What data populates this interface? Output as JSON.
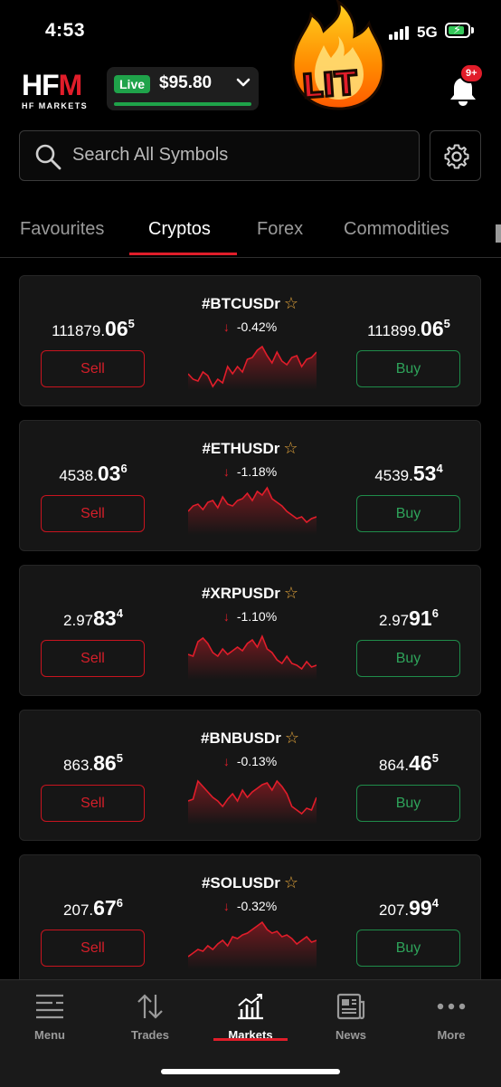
{
  "status": {
    "time": "4:53",
    "network": "5G"
  },
  "header": {
    "logo": {
      "mark": "HFM",
      "subtitle": "HF MARKETS"
    },
    "account": {
      "mode": "Live",
      "balance": "$95.80"
    },
    "sticker": {
      "text": "LIT"
    },
    "notifications": {
      "badge": "9+"
    }
  },
  "search": {
    "placeholder": "Search All Symbols"
  },
  "tabs": [
    "Favourites",
    "Cryptos",
    "Forex",
    "Commodities"
  ],
  "active_tab": "Cryptos",
  "instruments": [
    {
      "symbol": "#BTCUSDr",
      "change": "-0.42%",
      "sell": {
        "base": "111879.",
        "big": "06",
        "sup": "5"
      },
      "buy": {
        "base": "111899.",
        "big": "06",
        "sup": "5"
      },
      "sell_label": "Sell",
      "buy_label": "Buy"
    },
    {
      "symbol": "#ETHUSDr",
      "change": "-1.18%",
      "sell": {
        "base": "4538.",
        "big": "03",
        "sup": "6"
      },
      "buy": {
        "base": "4539.",
        "big": "53",
        "sup": "4"
      },
      "sell_label": "Sell",
      "buy_label": "Buy"
    },
    {
      "symbol": "#XRPUSDr",
      "change": "-1.10%",
      "sell": {
        "base": "2.97",
        "big": "83",
        "sup": "4"
      },
      "buy": {
        "base": "2.97",
        "big": "91",
        "sup": "6"
      },
      "sell_label": "Sell",
      "buy_label": "Buy"
    },
    {
      "symbol": "#BNBUSDr",
      "change": "-0.13%",
      "sell": {
        "base": "863.",
        "big": "86",
        "sup": "5"
      },
      "buy": {
        "base": "864.",
        "big": "46",
        "sup": "5"
      },
      "sell_label": "Sell",
      "buy_label": "Buy"
    },
    {
      "symbol": "#SOLUSDr",
      "change": "-0.32%",
      "sell": {
        "base": "207.",
        "big": "67",
        "sup": "6"
      },
      "buy": {
        "base": "207.",
        "big": "99",
        "sup": "4"
      },
      "sell_label": "Sell",
      "buy_label": "Buy"
    }
  ],
  "bottom_nav": [
    "Menu",
    "Trades",
    "Markets",
    "News",
    "More"
  ],
  "active_nav": "Markets",
  "colors": {
    "accent_red": "#e11d2a",
    "buy_green": "#1f8c4a",
    "live_green": "#1fa34a",
    "star": "#e0a23a"
  }
}
